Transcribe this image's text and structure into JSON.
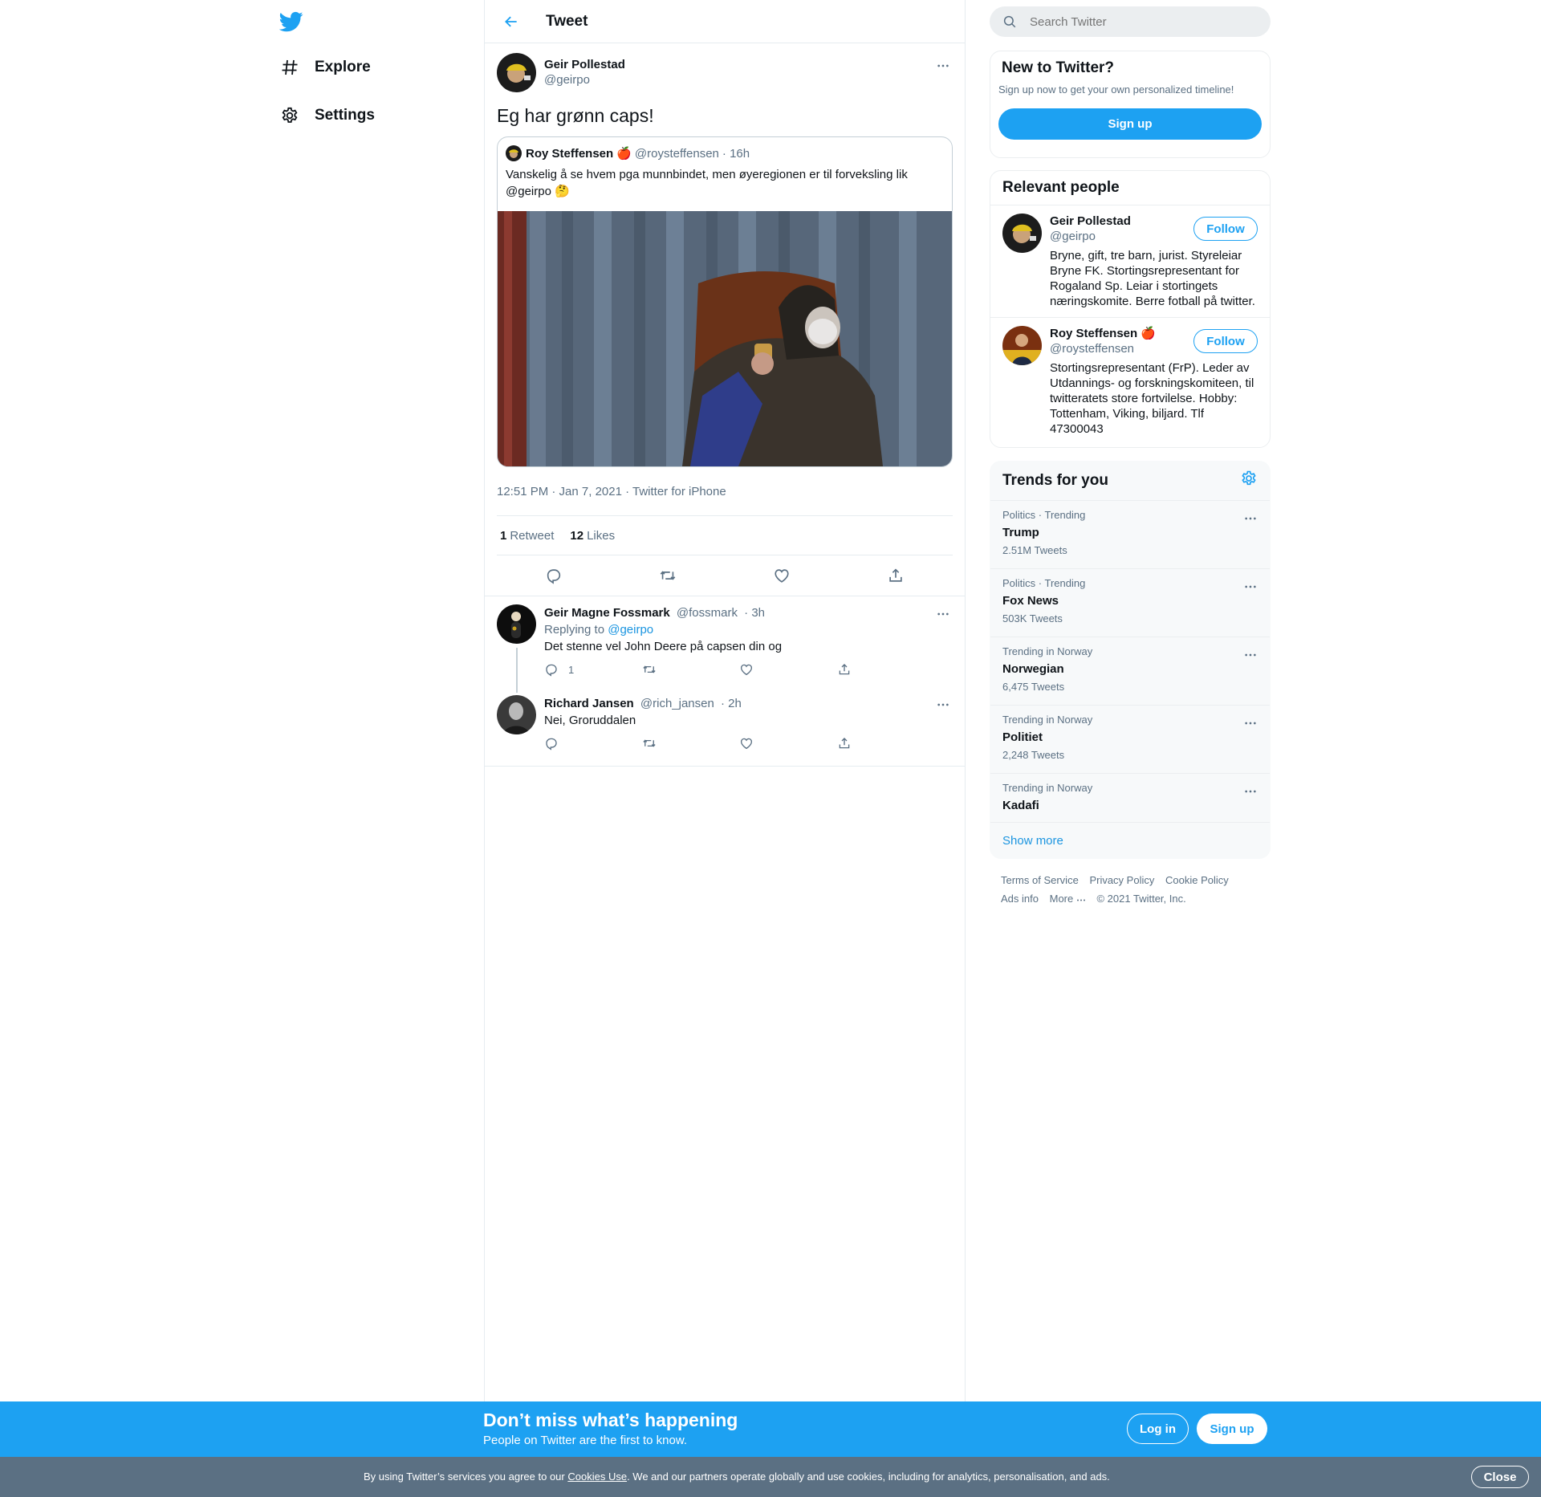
{
  "nav": {
    "explore": "Explore",
    "settings": "Settings"
  },
  "header": {
    "title": "Tweet"
  },
  "tweet": {
    "author_name": "Geir Pollestad",
    "author_handle": "@geirpo",
    "text": "Eg har grønn caps!",
    "quote": {
      "author_name": "Roy Steffensen",
      "author_emoji": "🍎",
      "author_handle": "@roysteffensen",
      "time": "· 16h",
      "text": "Vanskelig å se hvem pga munnbindet, men øyeregionen er til forveksling lik @geirpo 🤔"
    },
    "meta": "12:51 PM · Jan 7, 2021 · Twitter for iPhone",
    "retweets_count": "1",
    "retweets_label": "Retweet",
    "likes_count": "12",
    "likes_label": "Likes"
  },
  "replies": [
    {
      "author_name": "Geir Magne Fossmark",
      "author_handle": "@fossmark",
      "time": "· 3h",
      "replying_prefix": "Replying to",
      "replying_mention": "@geirpo",
      "text": "Det stenne vel John Deere på capsen din og",
      "reply_count": "1"
    },
    {
      "author_name": "Richard Jansen",
      "author_handle": "@rich_jansen",
      "time": "· 2h",
      "text": "Nei, Groruddalen"
    }
  ],
  "search": {
    "placeholder": "Search Twitter"
  },
  "signup_card": {
    "title": "New to Twitter?",
    "subtitle": "Sign up now to get your own personalized timeline!",
    "button": "Sign up"
  },
  "relevant": {
    "title": "Relevant people",
    "people": [
      {
        "name": "Geir Pollestad",
        "handle": "@geirpo",
        "bio": "Bryne, gift, tre barn, jurist. Styreleiar Bryne FK. Stortingsrepresentant for Rogaland Sp. Leiar i stortingets næringskomite. Berre fotball på twitter.",
        "follow": "Follow"
      },
      {
        "name": "Roy Steffensen",
        "emoji": "🍎",
        "handle": "@roysteffensen",
        "bio": "Stortingsrepresentant (FrP). Leder av Utdannings- og forskningskomiteen, til twitteratets store fortvilelse. Hobby: Tottenham, Viking, biljard. Tlf 47300043",
        "follow": "Follow"
      }
    ]
  },
  "trends": {
    "title": "Trends for you",
    "items": [
      {
        "context": "Politics · Trending",
        "name": "Trump",
        "count": "2.51M Tweets"
      },
      {
        "context": "Politics · Trending",
        "name": "Fox News",
        "count": "503K Tweets"
      },
      {
        "context": "Trending in Norway",
        "name": "Norwegian",
        "count": "6,475 Tweets"
      },
      {
        "context": "Trending in Norway",
        "name": "Politiet",
        "count": "2,248 Tweets"
      },
      {
        "context": "Trending in Norway",
        "name": "Kadafi",
        "count": ""
      }
    ],
    "show_more": "Show more"
  },
  "footer": {
    "terms": "Terms of Service",
    "privacy": "Privacy Policy",
    "cookie": "Cookie Policy",
    "ads": "Ads info",
    "more": "More",
    "copyright": "© 2021 Twitter, Inc."
  },
  "promo": {
    "title": "Don’t miss what’s happening",
    "subtitle": "People on Twitter are the first to know.",
    "login": "Log in",
    "signup": "Sign up"
  },
  "cookie_bar": {
    "text_before": "By using Twitter’s services you agree to our ",
    "link": "Cookies Use",
    "text_after": ". We and our partners operate globally and use cookies, including for analytics, personalisation, and ads.",
    "close": "Close"
  },
  "colors": {
    "accent": "#1da1f2",
    "link": "#1b95e0",
    "secondary_text": "#5b7083",
    "border": "#e6ecf0",
    "cookie_bar": "#5b7083"
  },
  "icons": [
    "twitter-logo-icon",
    "hashtag-icon",
    "gear-icon",
    "back-arrow-icon",
    "more-icon",
    "reply-icon",
    "retweet-icon",
    "like-icon",
    "share-icon",
    "search-icon"
  ]
}
